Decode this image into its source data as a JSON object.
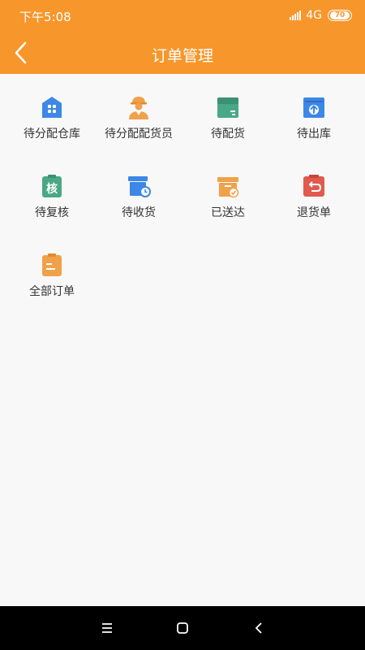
{
  "status_bar": {
    "time": "下午5:08",
    "network": "4G",
    "battery": "70"
  },
  "nav": {
    "title": "订单管理"
  },
  "menu": [
    {
      "label": "待分配仓库",
      "icon": "warehouse-icon"
    },
    {
      "label": "待分配配货员",
      "icon": "worker-icon"
    },
    {
      "label": "待配货",
      "icon": "box-icon"
    },
    {
      "label": "待出库",
      "icon": "outbound-icon"
    },
    {
      "label": "待复核",
      "icon": "review-icon"
    },
    {
      "label": "待收货",
      "icon": "receive-icon"
    },
    {
      "label": "已送达",
      "icon": "delivered-icon"
    },
    {
      "label": "退货单",
      "icon": "return-icon"
    },
    {
      "label": "全部订单",
      "icon": "all-orders-icon"
    }
  ],
  "review_icon_char": "核",
  "colors": {
    "header": "#f7962b",
    "blue": "#3d87e6",
    "orange": "#f0a14a",
    "green": "#49a885",
    "red": "#e05a4f"
  }
}
